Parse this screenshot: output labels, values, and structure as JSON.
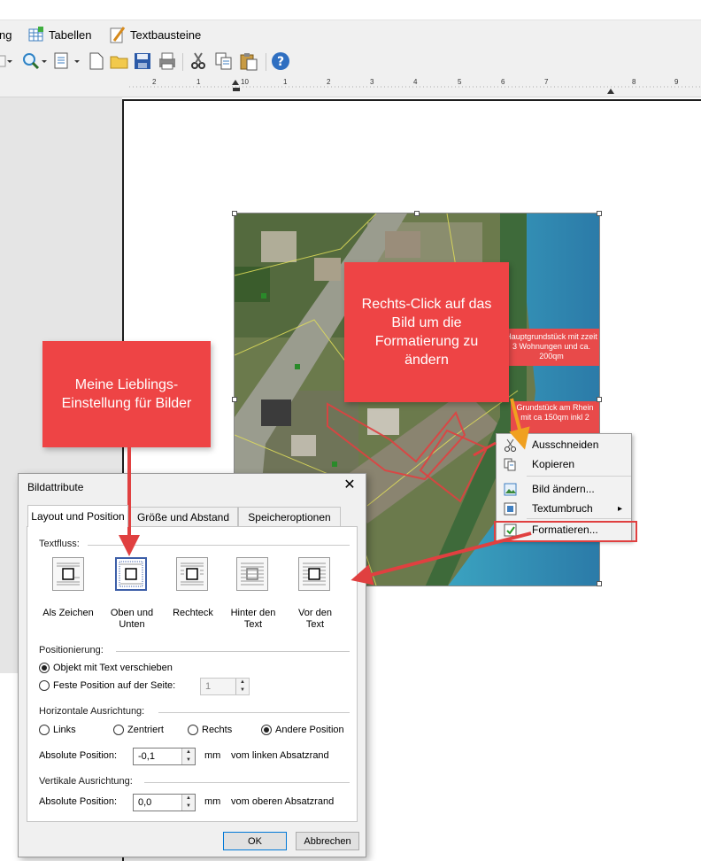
{
  "menubar": {
    "partial_item": "ng",
    "tables": "Tabellen",
    "textblocks": "Textbausteine"
  },
  "ruler": {
    "ticks": [
      "2",
      "1",
      "1",
      "2",
      "3",
      "4",
      "5",
      "6",
      "7",
      "8",
      "9",
      "10"
    ]
  },
  "callouts": {
    "right_click": "Rechts-Click auf das Bild um die Formatierung zu ändern",
    "favorite": "Meine Lieblings-Einstellung für Bilder"
  },
  "map_labels": {
    "main_plot": "Hauptgrundstück mit zzeit 3 Wohnungen und ca. 200qm",
    "second_plot": "Grundstück am Rhein mit ca 150qm inkl 2"
  },
  "context_menu": {
    "items": [
      "Ausschneiden",
      "Kopieren",
      "Bild ändern...",
      "Textumbruch",
      "Formatieren..."
    ],
    "submenu_arrow": "▸"
  },
  "dialog": {
    "title": "Bildattribute",
    "close": "✕",
    "tabs": [
      "Layout und Position",
      "Größe und Abstand",
      "Speicheroptionen"
    ],
    "textflow": {
      "label": "Textfluss:",
      "options": [
        {
          "line1": "Als Zeichen",
          "line2": ""
        },
        {
          "line1": "Oben und",
          "line2": "Unten"
        },
        {
          "line1": "Rechteck",
          "line2": ""
        },
        {
          "line1": "Hinter den",
          "line2": "Text"
        },
        {
          "line1": "Vor den",
          "line2": "Text"
        }
      ],
      "selected": "Oben und Unten"
    },
    "positioning": {
      "label": "Positionierung:",
      "move_with_text": "Objekt mit Text verschieben",
      "fixed_on_page": "Feste Position auf der Seite:",
      "page_value": "1"
    },
    "horizontal": {
      "label": "Horizontale Ausrichtung:",
      "options": [
        "Links",
        "Zentriert",
        "Rechts",
        "Andere Position"
      ],
      "selected": "Andere Position",
      "abs_label": "Absolute Position:",
      "abs_value": "-0,1",
      "unit": "mm",
      "ref": "vom linken Absatzrand"
    },
    "vertical": {
      "label": "Vertikale Ausrichtung:",
      "abs_label": "Absolute Position:",
      "abs_value": "0,0",
      "unit": "mm",
      "ref": "vom oberen Absatzrand"
    },
    "ok": "OK",
    "cancel": "Abbrechen"
  },
  "colors": {
    "callout": "#ee4445",
    "highlight": "#e04040",
    "arrow_orange": "#f0a020",
    "map_water": "#3d8fb5"
  }
}
